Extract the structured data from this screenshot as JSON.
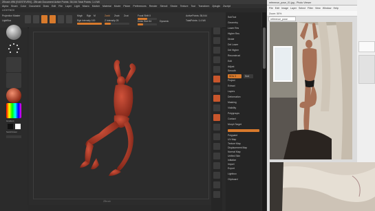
{
  "zbrush": {
    "title": "ZBrush 4R6 [SIGSTEVEN] - ZBrush Document     Active Points: 38,044   Total Points: 1.4 Mil",
    "menu": [
      "Alpha",
      "Brush",
      "Color",
      "Document",
      "Draw",
      "Edit",
      "File",
      "Layer",
      "Light",
      "Macro",
      "Marker",
      "Material",
      "Movie",
      "Picker",
      "Preferences",
      "Render",
      "Stencil",
      "Stroke",
      "Texture",
      "Tool",
      "Transform",
      "Zplugin",
      "Zscript"
    ],
    "subtitle": "LIGHTBOX",
    "topbar": {
      "projection_master": "Projection Master",
      "lightbox": "LightBox",
      "edit": "Edit",
      "draw": "Draw",
      "move": "Move",
      "scale": "Scale",
      "rotate": "Rotate",
      "mrgb": "Mrgb",
      "rgb": "Rgb",
      "m": "M",
      "zadd": "Zadd",
      "zsub": "Zsub",
      "zcut": "Zcut",
      "focal_shift": "Focal Shift 0",
      "z_intensity": "Z Intensity 25",
      "draw_size": "Draw Size 64",
      "dynamic": "Dynamic",
      "rgb_intensity": "Rgb Intensity 100",
      "active_points": "ActivePoints: 38,044",
      "total_points": "TotalPoints: 1.4 Mil"
    },
    "shelf": {
      "gradient_label": "Gradient",
      "switch_color_label": "SwitchColor"
    },
    "panel": {
      "rows": [
        "SubTool",
        "Geometry",
        "Lower Res",
        "Higher Res",
        "Divide",
        "Del Lower",
        "Del Higher",
        "Reconstruct",
        "Edit",
        "Adjust",
        "Smooth",
        "Project",
        "Extract",
        "Layers",
        "Deformation",
        "Masking",
        "Visibility",
        "Polygroups",
        "Contact",
        "Morph Target",
        "Polypaint",
        "UV Map",
        "Texture Map",
        "Displacement Map",
        "Normal Map",
        "Unified Skin",
        "Initialize",
        "Import",
        "Export",
        "Lightbox",
        "Clipboard"
      ],
      "sdiv": "SDiv 3",
      "smt": "Smt"
    },
    "canvas_label": "ZBrush"
  },
  "viewer": {
    "title": "reference_pose_01.jpg - Photo Viewer",
    "menu": [
      "File",
      "Edit",
      "Image",
      "Layer",
      "Select",
      "Filter",
      "View",
      "Window",
      "Help"
    ],
    "tool": "Zoom: 50%",
    "tab": "reference_pose"
  },
  "colors": {
    "accent": "#d87a2c",
    "model": "#b13a28",
    "panel_bg": "#252525"
  }
}
